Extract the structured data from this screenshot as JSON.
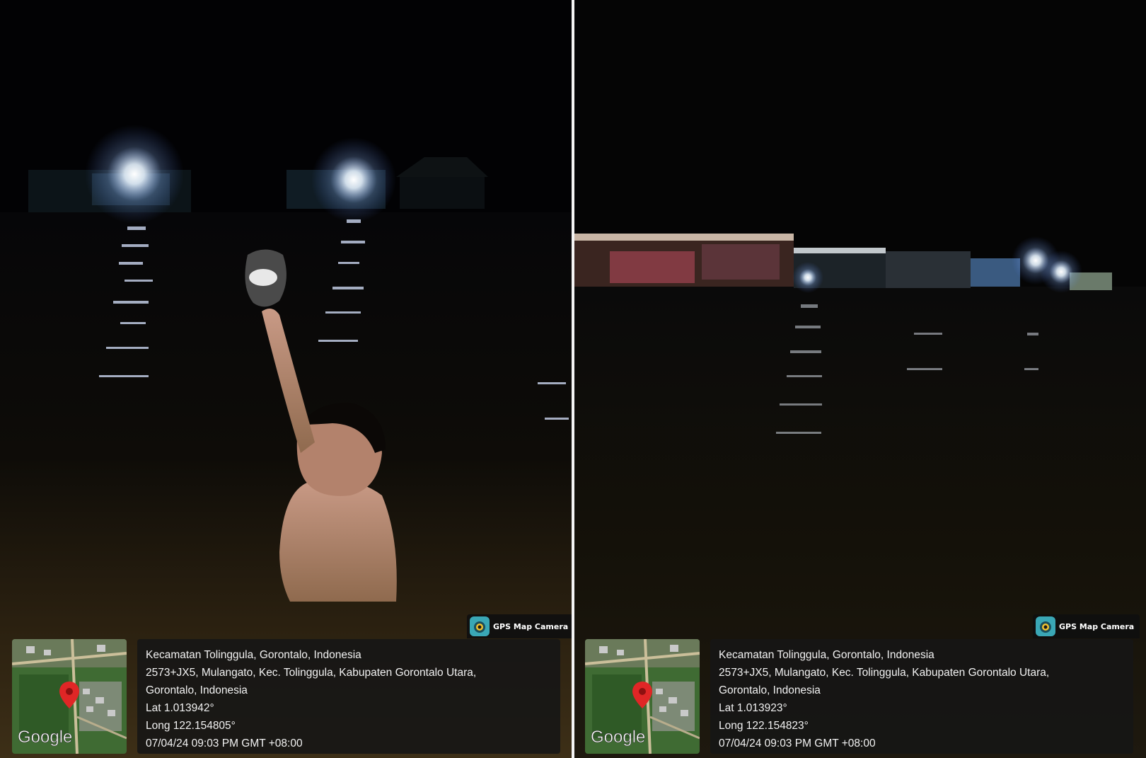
{
  "photos": [
    {
      "app_badge": {
        "name": "GPS Map Camera",
        "icon": "gps-map-camera-icon"
      },
      "map": {
        "brand": "Google",
        "icon": "map-pin-icon"
      },
      "location": {
        "title": "Kecamatan Tolinggula, Gorontalo, Indonesia",
        "address_line1": "2573+JX5, Mulangato, Kec. Tolinggula, Kabupaten Gorontalo Utara,",
        "address_line2": "Gorontalo, Indonesia",
        "lat": "Lat 1.013942°",
        "long": "Long 122.154805°",
        "datetime": "07/04/24 09:03 PM GMT +08:00"
      }
    },
    {
      "app_badge": {
        "name": "GPS Map Camera",
        "icon": "gps-map-camera-icon"
      },
      "map": {
        "brand": "Google",
        "icon": "map-pin-icon"
      },
      "location": {
        "title": "Kecamatan Tolinggula, Gorontalo, Indonesia",
        "address_line1": "2573+JX5, Mulangato, Kec. Tolinggula, Kabupaten Gorontalo Utara,",
        "address_line2": "Gorontalo, Indonesia",
        "lat": "Lat 1.013923°",
        "long": "Long 122.154823°",
        "datetime": "07/04/24 09:03 PM GMT +08:00"
      }
    }
  ],
  "colors": {
    "water_dark": "#0d0a06",
    "water_lit": "#3a2c14",
    "overlay": "#161616",
    "pin": "#e02626"
  }
}
